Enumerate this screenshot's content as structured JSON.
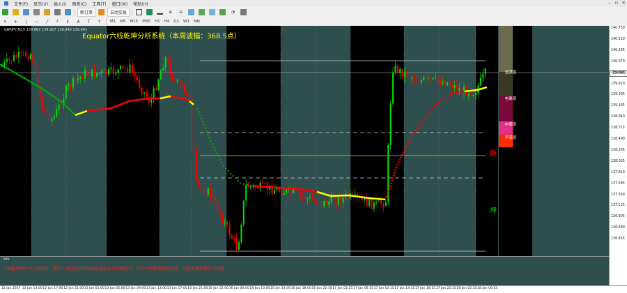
{
  "menu": [
    "文件(F)",
    "显示(V)",
    "插入(I)",
    "图表(C)",
    "工具(T)",
    "窗口(W)",
    "帮助(H)"
  ],
  "toolbar": {
    "new_order": "新订单",
    "auto_trading": "自动交易",
    "timeframes": [
      "M1",
      "M5",
      "M15",
      "M30",
      "H1",
      "H4",
      "D1",
      "W1",
      "MN"
    ]
  },
  "chart": {
    "header": "GBPJPY,M15  139.862 139.917 139.848 139.891",
    "title": "Equator六线乾坤分析系统（本周波幅：368.5点）",
    "zones": [
      "远强层",
      "电离层",
      "中流层",
      "平流层"
    ],
    "qian": "乾",
    "kun": "坤",
    "current_price": "139.891",
    "price_ticks": [
      "140.750",
      "140.520",
      "140.295",
      "140.070",
      "139.845",
      "139.620",
      "139.395",
      "139.165",
      "138.940",
      "138.715",
      "138.490",
      "138.265",
      "138.035",
      "137.810",
      "137.585",
      "137.360",
      "137.135",
      "136.905",
      "136.680",
      "136.455"
    ],
    "time_ticks": [
      "12 Jan 2017",
      "12 Jan 13:00",
      "12 Jan 17:00",
      "12 Jan 21:00",
      "13 Jan 01:00",
      "13 Jan 05:00",
      "13 Jan 09:00",
      "13 Jan 13:00",
      "13 Jan 17:00",
      "16 Jan 21:00",
      "16 Jan 02:00",
      "16 Jan 06:00",
      "16 Jan 10:00",
      "16 Jan 14:00",
      "16 Jan 18:00",
      "16 Jan 22:10",
      "17 Jan 02:15",
      "17 Jan 06:15",
      "17 Jan 10:15",
      "17 Jan 14:15",
      "17 Jan 18:15",
      "17 Jan 22:15",
      "18 Jan 02:15",
      "18 Jan 06:15"
    ],
    "colors": {
      "background": "#2f4e4e",
      "dark_band": "#000000",
      "bull": "#00e000",
      "bear": "#ff0000",
      "ma_up": "#ff0000",
      "ma_down": "#00b000",
      "ma_flat": "#ffff00"
    }
  },
  "info": {
    "title": "Info",
    "message": "六线乾坤图作为分析后台！提示：经过相对均线系统发出多空转换信号，作为分析参考辅助信息，切忌单独使用作为依据"
  }
}
